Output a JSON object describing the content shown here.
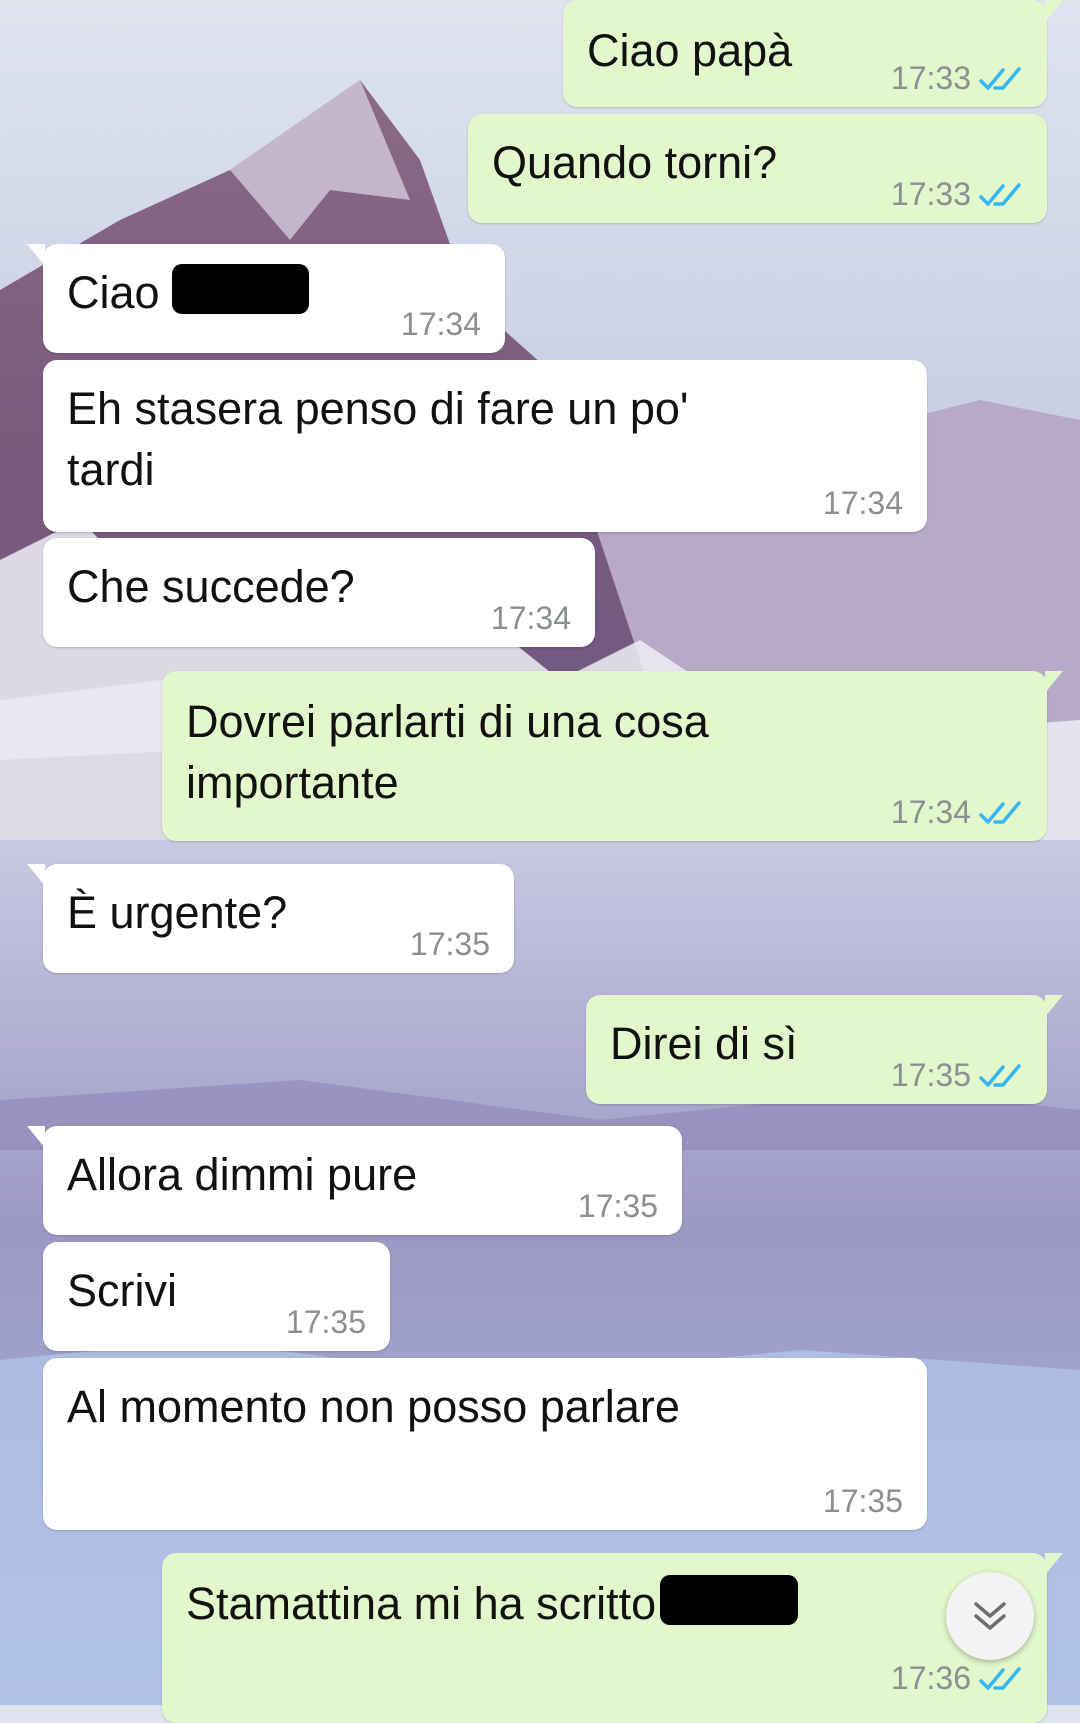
{
  "messages": [
    {
      "text": "Ciao papà",
      "time": "17:33",
      "read": true
    },
    {
      "text": "Quando torni?",
      "time": "17:33",
      "read": true
    },
    {
      "text": "Ciao",
      "time": "17:34"
    },
    {
      "text": "Eh stasera penso di fare un po'\ntardi",
      "time": "17:34"
    },
    {
      "text": "Che succede?",
      "time": "17:34"
    },
    {
      "text": "Dovrei parlarti di una cosa\nimportante",
      "time": "17:34",
      "read": true
    },
    {
      "text": "È urgente?",
      "time": "17:35"
    },
    {
      "text": "Direi di sì",
      "time": "17:35",
      "read": true
    },
    {
      "text": "Allora dimmi pure",
      "time": "17:35"
    },
    {
      "text": "Scrivi",
      "time": "17:35"
    },
    {
      "text": "Al momento non posso parlare",
      "time": "17:35"
    },
    {
      "text": "Stamattina mi ha scritto",
      "time": "17:36",
      "read": true
    }
  ],
  "icons": {
    "read_receipt": "double-check-icon",
    "scroll_down": "chevron-down-double-icon"
  },
  "colors": {
    "incoming": "#ffffff",
    "outgoing": "#e2f7cb",
    "tick": "#34b7f1",
    "time": "#8a8f92"
  }
}
